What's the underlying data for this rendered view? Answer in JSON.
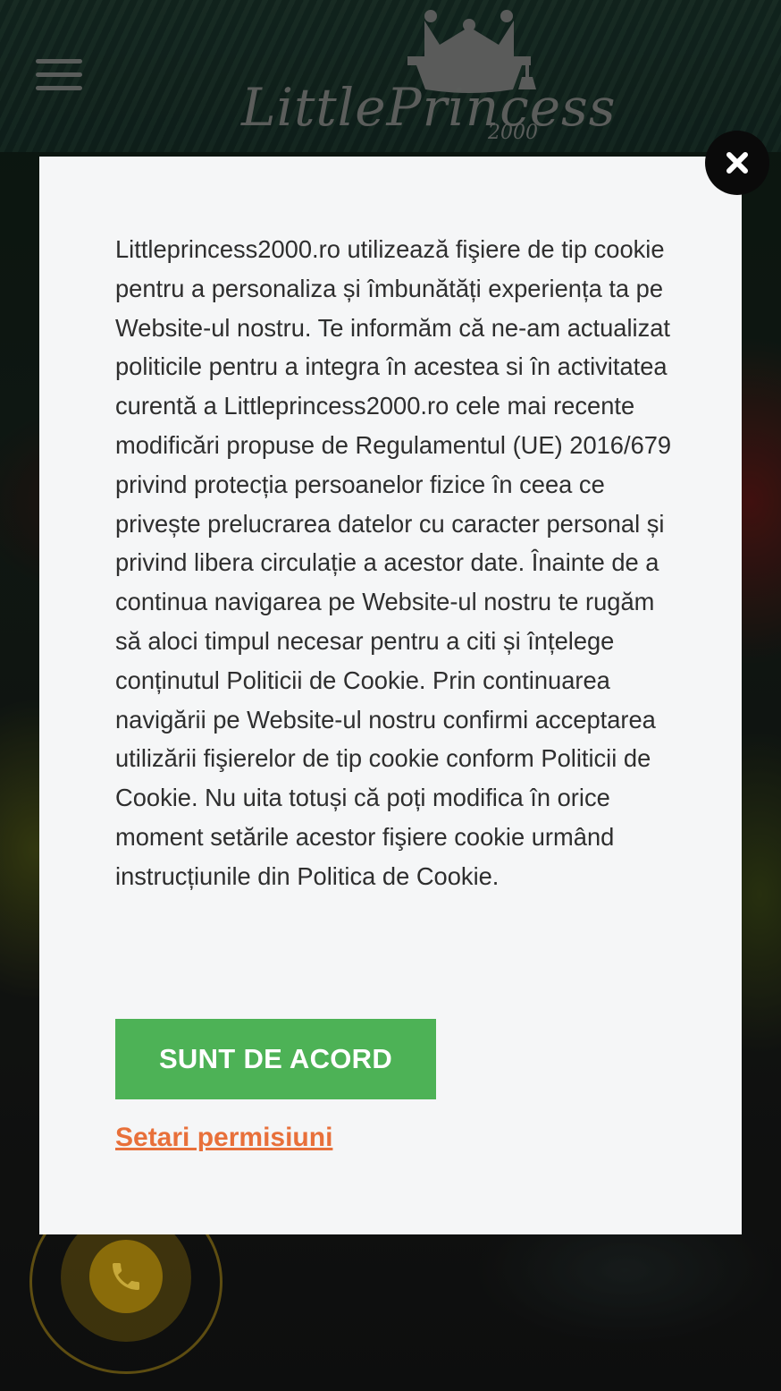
{
  "header": {
    "logo_text": "LittlePrincess",
    "logo_subtext": "2000"
  },
  "cookie_modal": {
    "message": "Littleprincess2000.ro utilizează fişiere de tip cookie pentru a personaliza și îmbunătăți experiența ta pe Website-ul nostru. Te informăm că ne-am actualizat politicile pentru a integra în acestea si în activitatea curentă a Littleprincess2000.ro cele mai recente modificări propuse de Regulamentul (UE) 2016/679 privind protecția persoanelor fizice în ceea ce privește prelucrarea datelor cu caracter personal și privind libera circulație a acestor date. Înainte de a continua navigarea pe Website-ul nostru te rugăm să aloci timpul necesar pentru a citi și înțelege conținutul Politicii de Cookie. Prin continuarea navigării pe Website-ul nostru confirmi acceptarea utilizării fişierelor de tip cookie conform Politicii de Cookie. Nu uita totuși că poți modifica în orice moment setările acestor fişiere cookie urmând instrucțiunile din Politica de Cookie.",
    "agree_label": "SUNT DE ACORD",
    "settings_label": "Setari permisiuni"
  },
  "colors": {
    "agree_button": "#4db256",
    "settings_link": "#e8703a",
    "modal_background": "#f5f6f7"
  },
  "icons": {
    "close": "close-icon",
    "menu": "hamburger-menu-icon",
    "phone": "phone-icon"
  }
}
